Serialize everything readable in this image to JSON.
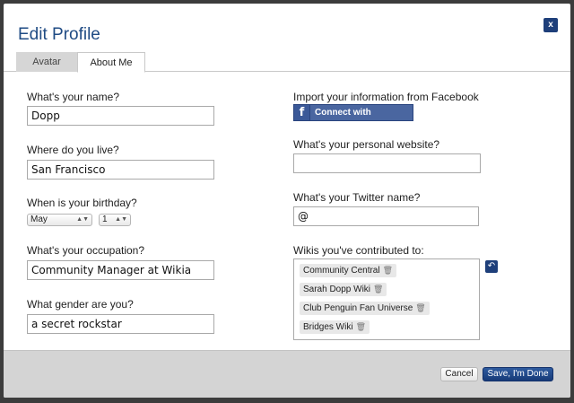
{
  "dialog": {
    "title": "Edit Profile",
    "close_label": "x"
  },
  "tabs": [
    {
      "label": "Avatar",
      "active": false
    },
    {
      "label": "About Me",
      "active": true
    }
  ],
  "left_fields": {
    "name": {
      "label": "What's your name?",
      "value": "Dopp"
    },
    "location": {
      "label": "Where do you live?",
      "value": "San Francisco"
    },
    "birthday": {
      "label": "When is your birthday?",
      "month": "May",
      "day": "1"
    },
    "occupation": {
      "label": "What's your occupation?",
      "value": "Community Manager at Wikia"
    },
    "gender": {
      "label": "What gender are you?",
      "value": "a secret rockstar"
    }
  },
  "right_fields": {
    "facebook": {
      "label": "Import your information from Facebook",
      "button_label": "Connect with Facebook",
      "icon_glyph": "f"
    },
    "website": {
      "label": "What's your personal website?",
      "value": ""
    },
    "twitter": {
      "label": "What's your Twitter name?",
      "value": "@"
    },
    "wikis": {
      "label": "Wikis you've contributed to:",
      "items": [
        "Community Central",
        "Sarah Dopp Wiki",
        "Club Penguin Fan Universe",
        "Bridges Wiki"
      ]
    }
  },
  "footer": {
    "cancel_label": "Cancel",
    "save_label": "Save, I'm Done"
  },
  "colors": {
    "title_blue": "#1f4b84",
    "button_navy": "#1e3f7a",
    "facebook_blue": "#4a66a0",
    "footer_gray": "#d4d4d4"
  },
  "icons": [
    "close-icon",
    "facebook-icon",
    "trash-icon",
    "refresh-icon",
    "chevron-down-icon"
  ]
}
